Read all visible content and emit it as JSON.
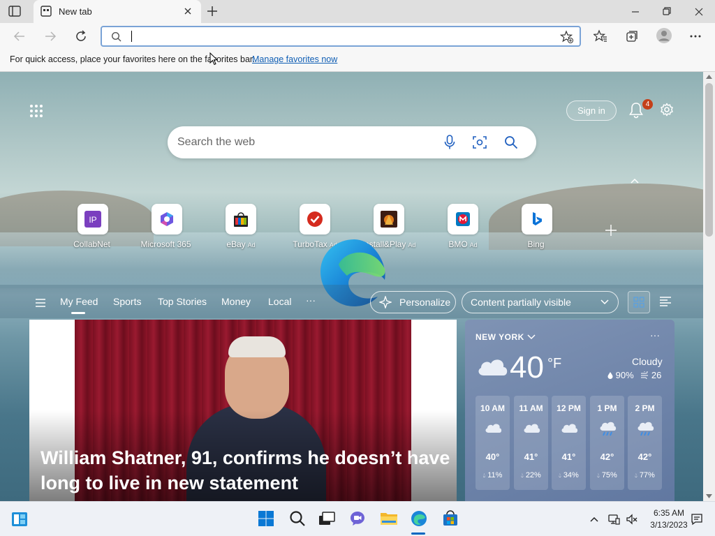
{
  "browser": {
    "tab_title": "New tab",
    "address_value": "",
    "favorites_bar": {
      "message": "For quick access, place your favorites here on the favorites bar.",
      "link": "Manage favorites now"
    }
  },
  "ntp": {
    "sign_in": "Sign in",
    "notification_count": "4",
    "search_placeholder": "Search the web",
    "quick_links": [
      {
        "label": "CollabNet",
        "ad": ""
      },
      {
        "label": "Microsoft 365",
        "ad": ""
      },
      {
        "label": "eBay",
        "ad": "Ad"
      },
      {
        "label": "TurboTax",
        "ad": "Ad"
      },
      {
        "label": "Install&Play",
        "ad": "Ad"
      },
      {
        "label": "BMO",
        "ad": "Ad"
      },
      {
        "label": "Bing",
        "ad": ""
      }
    ],
    "quick_link_icons": {
      "collabnet": "IP",
      "collab_color": "#7b3fbf"
    },
    "feed_tabs": [
      "My Feed",
      "Sports",
      "Top Stories",
      "Money",
      "Local"
    ],
    "more_tabs": "···",
    "personalize": "Personalize",
    "content_visibility": "Content partially visible",
    "hero": {
      "title": "William Shatner, 91, confirms he doesn’t have long to live in new statement"
    },
    "weather": {
      "city": "NEW YORK",
      "temp": "40",
      "unit": "°F",
      "condition": "Cloudy",
      "humidity": "90%",
      "wind": "26",
      "hourly": [
        {
          "time": "10 AM",
          "temp": "40°",
          "precip": "11%",
          "icon": "cloud"
        },
        {
          "time": "11 AM",
          "temp": "41°",
          "precip": "22%",
          "icon": "cloud"
        },
        {
          "time": "12 PM",
          "temp": "41°",
          "precip": "34%",
          "icon": "cloud"
        },
        {
          "time": "1 PM",
          "temp": "42°",
          "precip": "75%",
          "icon": "rain"
        },
        {
          "time": "2 PM",
          "temp": "42°",
          "precip": "77%",
          "icon": "rain"
        }
      ]
    }
  },
  "taskbar": {
    "time": "6:35 AM",
    "date": "3/13/2023"
  },
  "colors": {
    "accent": "#0067c0",
    "link": "#0f5eb4",
    "badge": "#c4401a"
  }
}
